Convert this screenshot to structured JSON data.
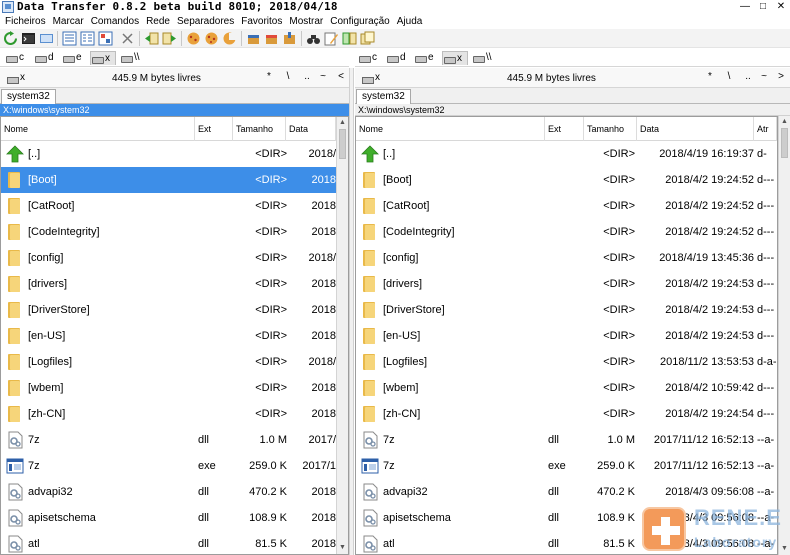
{
  "window": {
    "title": "Data Transfer 0.8.2 beta build 8010; 2018/04/18",
    "controls": [
      "—",
      "□",
      "✕"
    ]
  },
  "menu": [
    "Ficheiros",
    "Marcar",
    "Comandos",
    "Rede",
    "Separadores",
    "Favoritos",
    "Mostrar",
    "Configuração",
    "Ajuda"
  ],
  "toolbar_icons": [
    "refresh-icon",
    "terminal-icon",
    "network-icon",
    "view-brief-icon",
    "view-full-icon",
    "view-tree-icon",
    "split-icon",
    "copy-left-icon",
    "copy-right-icon",
    "cookie-icon",
    "cookie-2-icon",
    "cookie-3-icon",
    "package-icon",
    "package-2-icon",
    "package-3-icon",
    "binoculars-icon",
    "edit-icon",
    "compare-icon",
    "multi-rename-icon"
  ],
  "drives_left": [
    {
      "label": "c",
      "active": false
    },
    {
      "label": "d",
      "active": false
    },
    {
      "label": "e",
      "active": false
    },
    {
      "label": "x",
      "active": true
    },
    {
      "label": "\\\\",
      "active": false
    }
  ],
  "drives_right": [
    {
      "label": "c",
      "active": false
    },
    {
      "label": "d",
      "active": false
    },
    {
      "label": "e",
      "active": false
    },
    {
      "label": "x",
      "active": true
    },
    {
      "label": "\\\\",
      "active": false
    }
  ],
  "left_panel": {
    "drive": "x",
    "free": "445.9 M bytes livres",
    "nav": [
      "*",
      "\\",
      "..",
      "~",
      "<"
    ],
    "tab": "system32",
    "path": "X:\\windows\\system32",
    "columns": [
      "Nome",
      "Ext",
      "Tamanho",
      "Data"
    ],
    "rows": [
      {
        "name": "[..]",
        "ext": "",
        "size": "<DIR>",
        "date": "2018/",
        "icon": "up"
      },
      {
        "name": "[Boot]",
        "ext": "",
        "size": "<DIR>",
        "date": "2018",
        "icon": "folder",
        "selected": true
      },
      {
        "name": "[CatRoot]",
        "ext": "",
        "size": "<DIR>",
        "date": "2018",
        "icon": "folder"
      },
      {
        "name": "[CodeIntegrity]",
        "ext": "",
        "size": "<DIR>",
        "date": "2018",
        "icon": "folder"
      },
      {
        "name": "[config]",
        "ext": "",
        "size": "<DIR>",
        "date": "2018/",
        "icon": "folder"
      },
      {
        "name": "[drivers]",
        "ext": "",
        "size": "<DIR>",
        "date": "2018",
        "icon": "folder"
      },
      {
        "name": "[DriverStore]",
        "ext": "",
        "size": "<DIR>",
        "date": "2018",
        "icon": "folder"
      },
      {
        "name": "[en-US]",
        "ext": "",
        "size": "<DIR>",
        "date": "2018",
        "icon": "folder"
      },
      {
        "name": "[Logfiles]",
        "ext": "",
        "size": "<DIR>",
        "date": "2018/",
        "icon": "folder"
      },
      {
        "name": "[wbem]",
        "ext": "",
        "size": "<DIR>",
        "date": "2018",
        "icon": "folder"
      },
      {
        "name": "[zh-CN]",
        "ext": "",
        "size": "<DIR>",
        "date": "2018",
        "icon": "folder"
      },
      {
        "name": "7z",
        "ext": "dll",
        "size": "1.0 M",
        "date": "2017/",
        "icon": "dll"
      },
      {
        "name": "7z",
        "ext": "exe",
        "size": "259.0 K",
        "date": "2017/1",
        "icon": "exe"
      },
      {
        "name": "advapi32",
        "ext": "dll",
        "size": "470.2 K",
        "date": "2018",
        "icon": "dll"
      },
      {
        "name": "apisetschema",
        "ext": "dll",
        "size": "108.9 K",
        "date": "2018",
        "icon": "dll"
      },
      {
        "name": "atl",
        "ext": "dll",
        "size": "81.5 K",
        "date": "2018",
        "icon": "dll"
      }
    ]
  },
  "right_panel": {
    "drive": "x",
    "free": "445.9 M bytes livres",
    "nav": [
      "*",
      "\\",
      "..",
      "~",
      ">"
    ],
    "tab": "system32",
    "path": "X:\\windows\\system32",
    "columns": [
      "Nome",
      "Ext",
      "Tamanho",
      "Data",
      "Atr"
    ],
    "rows": [
      {
        "name": "[..]",
        "ext": "",
        "size": "<DIR>",
        "date": "2018/4/19 16:19:37",
        "attr": "d-",
        "icon": "up"
      },
      {
        "name": "[Boot]",
        "ext": "",
        "size": "<DIR>",
        "date": "2018/4/2 19:24:52",
        "attr": "d---",
        "icon": "folder"
      },
      {
        "name": "[CatRoot]",
        "ext": "",
        "size": "<DIR>",
        "date": "2018/4/2 19:24:52",
        "attr": "d---",
        "icon": "folder"
      },
      {
        "name": "[CodeIntegrity]",
        "ext": "",
        "size": "<DIR>",
        "date": "2018/4/2 19:24:52",
        "attr": "d---",
        "icon": "folder"
      },
      {
        "name": "[config]",
        "ext": "",
        "size": "<DIR>",
        "date": "2018/4/19 13:45:36",
        "attr": "d---",
        "icon": "folder"
      },
      {
        "name": "[drivers]",
        "ext": "",
        "size": "<DIR>",
        "date": "2018/4/2 19:24:53",
        "attr": "d---",
        "icon": "folder"
      },
      {
        "name": "[DriverStore]",
        "ext": "",
        "size": "<DIR>",
        "date": "2018/4/2 19:24:53",
        "attr": "d---",
        "icon": "folder"
      },
      {
        "name": "[en-US]",
        "ext": "",
        "size": "<DIR>",
        "date": "2018/4/2 19:24:53",
        "attr": "d---",
        "icon": "folder"
      },
      {
        "name": "[Logfiles]",
        "ext": "",
        "size": "<DIR>",
        "date": "2018/11/2 13:53:53",
        "attr": "d-a-",
        "icon": "folder"
      },
      {
        "name": "[wbem]",
        "ext": "",
        "size": "<DIR>",
        "date": "2018/4/2 10:59:42",
        "attr": "d---",
        "icon": "folder"
      },
      {
        "name": "[zh-CN]",
        "ext": "",
        "size": "<DIR>",
        "date": "2018/4/2 19:24:54",
        "attr": "d---",
        "icon": "folder"
      },
      {
        "name": "7z",
        "ext": "dll",
        "size": "1.0 M",
        "date": "2017/11/12 16:52:13",
        "attr": "--a-",
        "icon": "dll"
      },
      {
        "name": "7z",
        "ext": "exe",
        "size": "259.0 K",
        "date": "2017/11/12 16:52:13",
        "attr": "--a-",
        "icon": "exe"
      },
      {
        "name": "advapi32",
        "ext": "dll",
        "size": "470.2 K",
        "date": "2018/4/3 09:56:08",
        "attr": "--a-",
        "icon": "dll"
      },
      {
        "name": "apisetschema",
        "ext": "dll",
        "size": "108.9 K",
        "date": "2018/4/3 09:56:08",
        "attr": "--a-",
        "icon": "dll"
      },
      {
        "name": "atl",
        "ext": "dll",
        "size": "81.5 K",
        "date": "2018/4/3 09:56:08",
        "attr": "--a-",
        "icon": "dll"
      }
    ]
  },
  "watermark": {
    "line1": "RENE.E",
    "line2": "Laboratory"
  },
  "colors": {
    "selection": "#3d8ee8",
    "folder": "#f6d57a",
    "up_arrow": "#3fae2a"
  }
}
